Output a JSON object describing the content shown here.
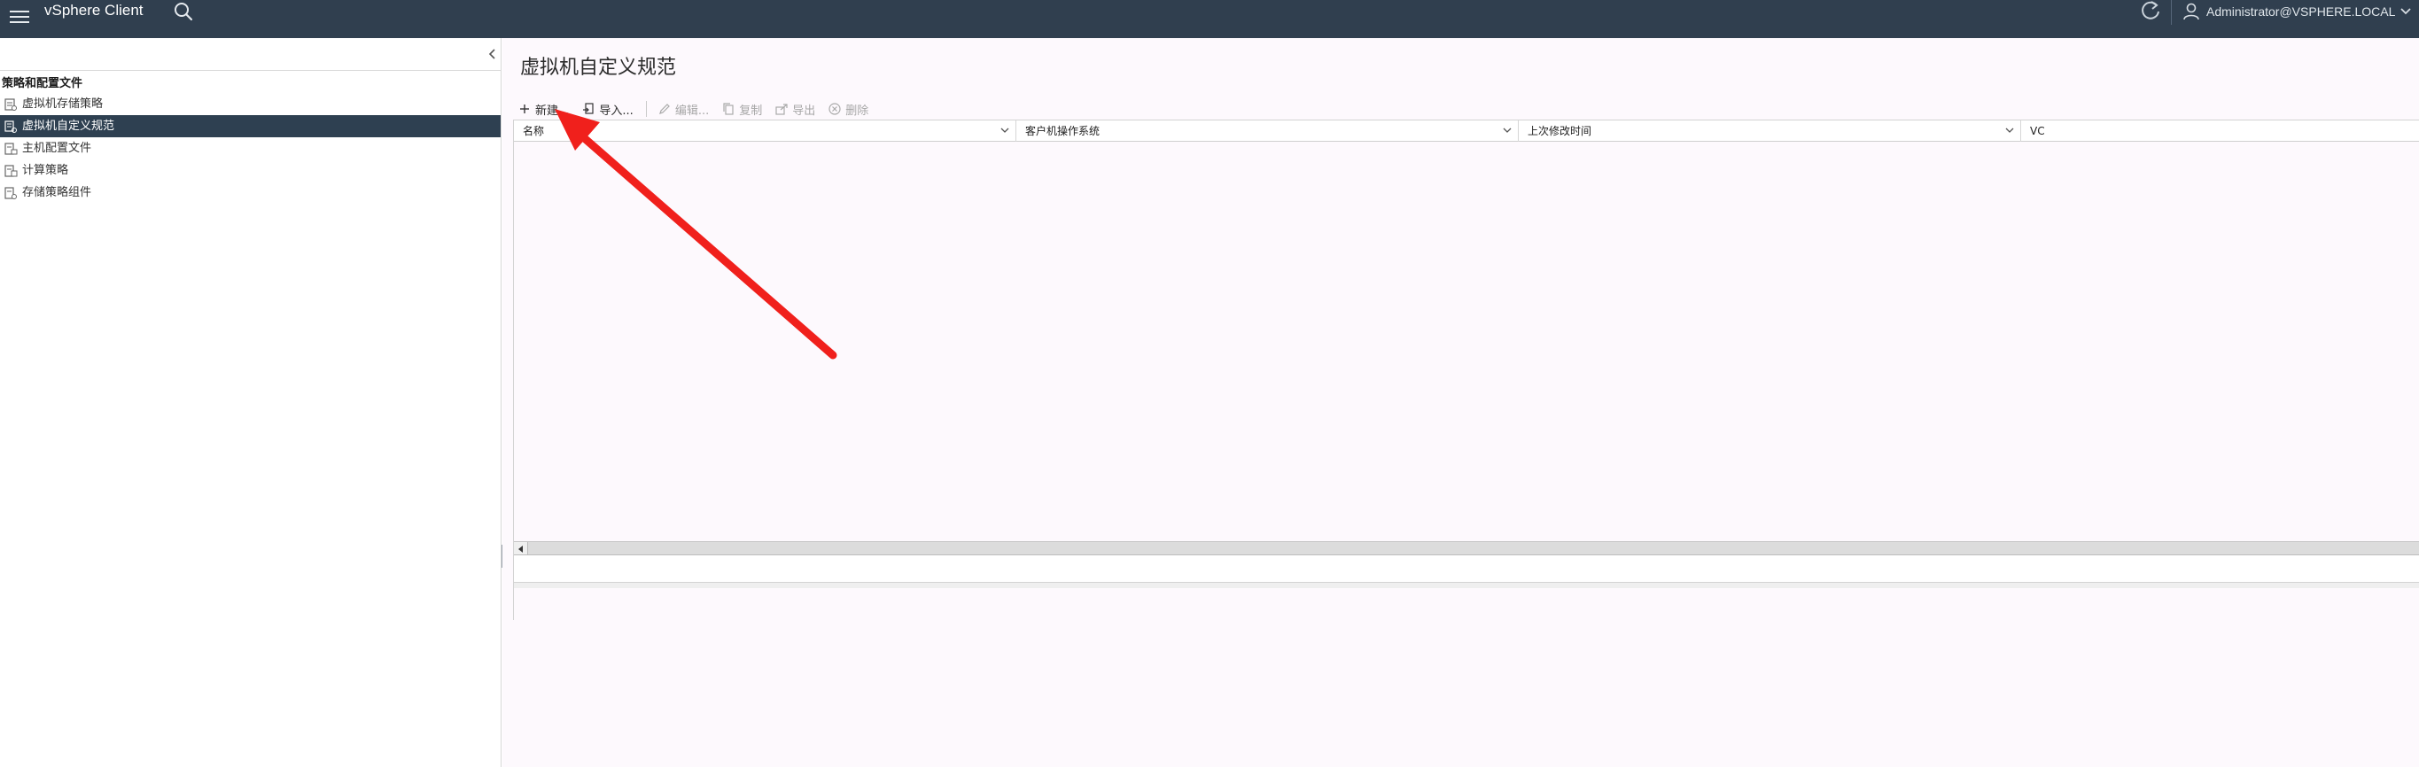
{
  "header": {
    "app_title": "vSphere Client",
    "menu_icon": "hamburger-menu-icon",
    "search_icon": "search-icon",
    "refresh_icon": "refresh-icon",
    "user_icon": "user-icon",
    "user_label": "Administrator@VSPHERE.LOCAL",
    "background_color": "#303f4f"
  },
  "sidebar": {
    "collapse_icon": "chevron-left-icon",
    "section_title": "策略和配置文件",
    "items": [
      {
        "label": "虚拟机存储策略",
        "icon": "storage-policy-icon",
        "selected": false
      },
      {
        "label": "虚拟机自定义规范",
        "icon": "customization-spec-icon",
        "selected": true
      },
      {
        "label": "主机配置文件",
        "icon": "host-profile-icon",
        "selected": false
      },
      {
        "label": "计算策略",
        "icon": "compute-policy-icon",
        "selected": false
      },
      {
        "label": "存储策略组件",
        "icon": "storage-component-icon",
        "selected": false
      }
    ],
    "selected_color": "#2e4051"
  },
  "main": {
    "title": "虚拟机自定义规范",
    "toolbar": {
      "new_label": "新建...",
      "import_label": "导入...",
      "edit_label": "编辑...",
      "copy_label": "复制",
      "export_label": "导出",
      "delete_label": "删除"
    },
    "columns": [
      {
        "label": "名称"
      },
      {
        "label": "客户机操作系统"
      },
      {
        "label": "上次修改时间"
      },
      {
        "label": "VC"
      }
    ]
  },
  "annotation": {
    "type": "arrow",
    "color": "#f0201c",
    "points_to": "new-button"
  }
}
